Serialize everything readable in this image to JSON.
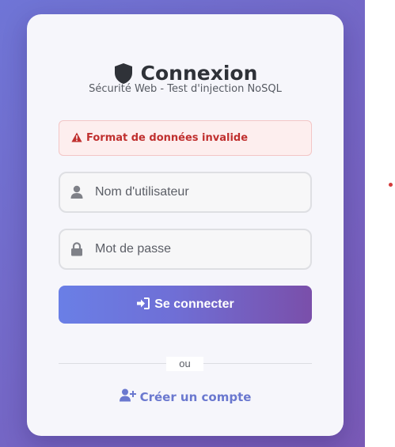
{
  "login": {
    "title": "Connexion",
    "subtitle": "Sécurité Web - Test d'injection NoSQL",
    "error_message": "Format de données invalide",
    "username_placeholder": "Nom d'utilisateur",
    "password_placeholder": "Mot de passe",
    "submit_label": "Se connecter",
    "divider_text": "ou",
    "create_account_label": "Créer un compte"
  },
  "icons": {
    "title": "shield-icon",
    "alert": "warning-triangle-icon",
    "username": "user-icon",
    "password": "lock-icon",
    "submit": "sign-in-icon",
    "create_account": "user-plus-icon"
  },
  "colors": {
    "background_gradient_start": "#6f75d6",
    "background_gradient_end": "#7a5ab7",
    "card": "#f6f6fb",
    "error_text": "#c0302f",
    "error_background": "#fdeeee",
    "button_gradient_start": "#6a7fe6",
    "button_gradient_end": "#7a4faa",
    "link": "#6a78cf"
  }
}
